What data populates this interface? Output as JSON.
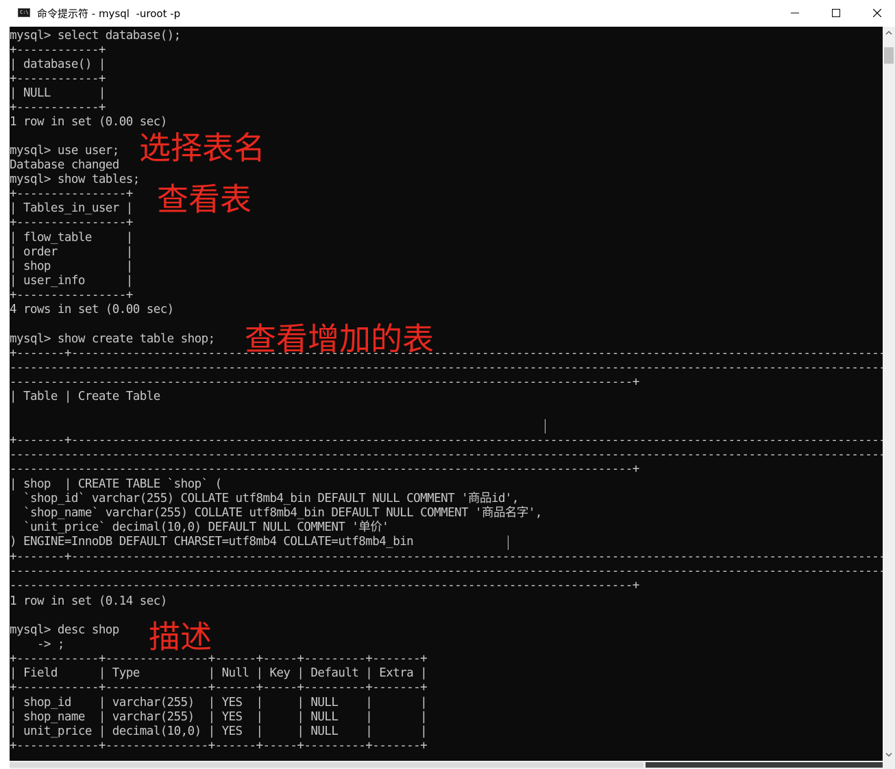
{
  "window": {
    "icon_text": "C:\\",
    "title": "命令提示符 - mysql  -uroot -p",
    "buttons": {
      "minimize": "minimize",
      "maximize": "maximize",
      "close": "close"
    }
  },
  "console": {
    "lines": [
      "mysql> select database();",
      "+------------+",
      "| database() |",
      "+------------+",
      "| NULL       |",
      "+------------+",
      "1 row in set (0.00 sec)",
      "",
      "mysql> use user;",
      "Database changed",
      "mysql> show tables;",
      "+----------------+",
      "| Tables_in_user |",
      "+----------------+",
      "| flow_table     |",
      "| order          |",
      "| shop           |",
      "| user_info      |",
      "+----------------+",
      "4 rows in set (0.00 sec)",
      "",
      "mysql> show create table shop;",
      "+-------+-------------------------------------------------------------------------------------------------------------------------------------------",
      "----------------------------------------------------------------------------------------------------------------------------------------------",
      "-------------------------------------------------------------------------------------------+",
      "| Table | Create Table",
      "",
      "",
      "",
      "+-------+-------------------------------------------------------------------------------------------------------------------------------------------",
      "----------------------------------------------------------------------------------------------------------------------------------------------",
      "-------------------------------------------------------------------------------------------+",
      "| shop  | CREATE TABLE `shop` (",
      "  `shop_id` varchar(255) COLLATE utf8mb4_bin DEFAULT NULL COMMENT '商品id',",
      "  `shop_name` varchar(255) COLLATE utf8mb4_bin DEFAULT NULL COMMENT '商品名字',",
      "  `unit_price` decimal(10,0) DEFAULT NULL COMMENT '单价'",
      ") ENGINE=InnoDB DEFAULT CHARSET=utf8mb4 COLLATE=utf8mb4_bin",
      "+-------+-------------------------------------------------------------------------------------------------------------------------------------------",
      "----------------------------------------------------------------------------------------------------------------------------------------------",
      "-------------------------------------------------------------------------------------------+",
      "",
      "1 row in set (0.14 sec)",
      "",
      "mysql> desc shop",
      "    -> ;",
      "+------------+---------------+------+-----+---------+-------+",
      "| Field      | Type          | Null | Key | Default | Extra |",
      "+------------+---------------+------+-----+---------+-------+",
      "| shop_id    | varchar(255)  | YES  |     | NULL    |       |",
      "| shop_name  | varchar(255)  | YES  |     | NULL    |       |",
      "| unit_price | decimal(10,0) | YES  |     | NULL    |       |",
      "+------------+---------------+------+-----+---------+-------+"
    ]
  },
  "annotations": {
    "select_table": "选择表名",
    "view_tables": "查看表",
    "view_added_table": "查看增加的表",
    "describe": "描述"
  },
  "colors": {
    "console_bg": "#0c0c0c",
    "console_text": "#c8c8c8",
    "annotation": "#e8281e"
  }
}
